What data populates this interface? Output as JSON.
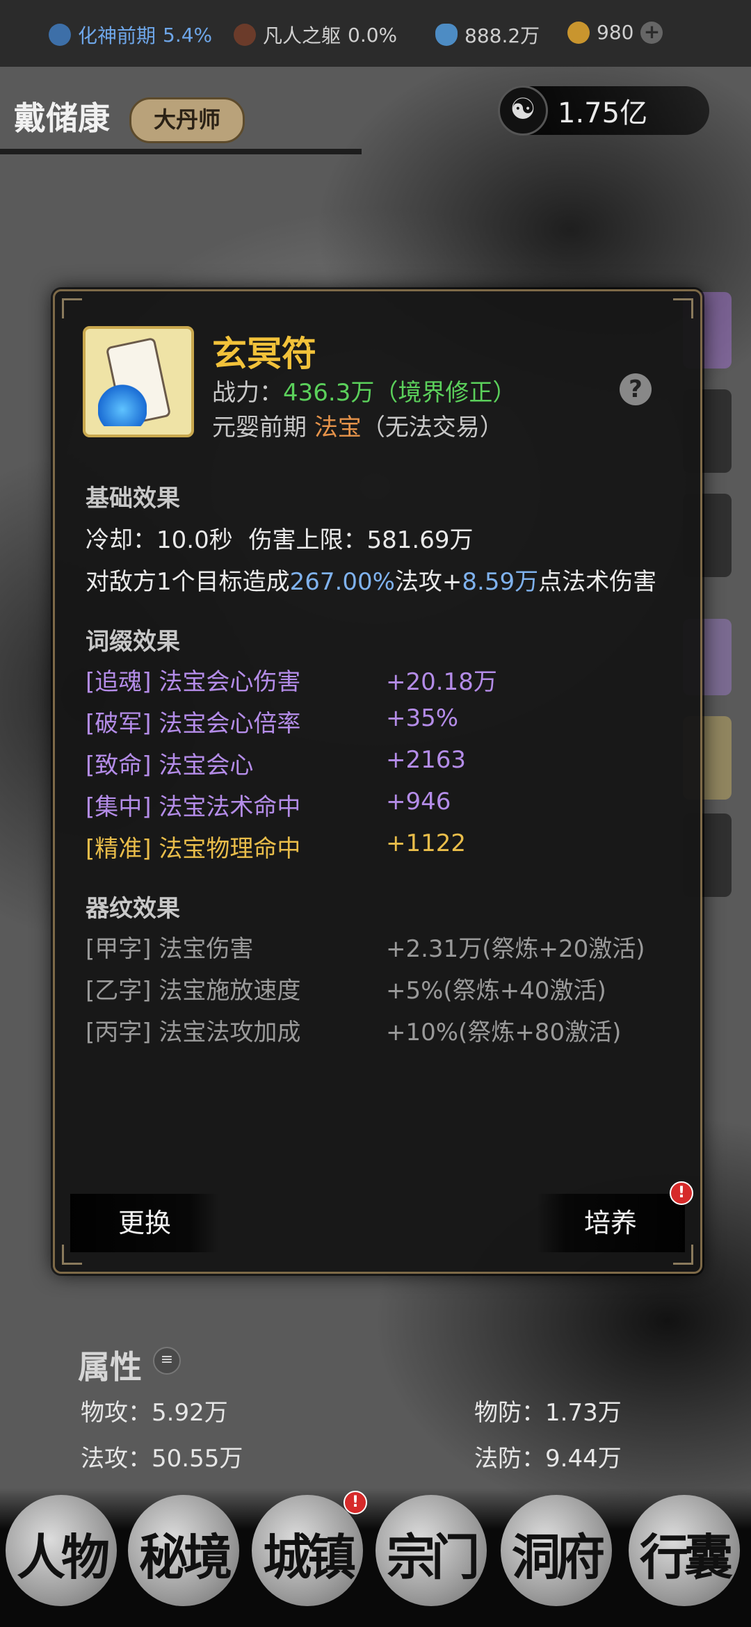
{
  "status_bar": {
    "realm": {
      "label": "化神前期",
      "value": "5.4%"
    },
    "body": {
      "label": "凡人之躯",
      "value": "0.0%"
    },
    "spirit_stones": "888.2万",
    "gold": "980",
    "add_symbol": "+"
  },
  "header": {
    "player_name": "戴储康",
    "title_badge": "大丹师",
    "currency_value": "1.75亿",
    "currency_icon": "taiji-icon"
  },
  "item": {
    "name": "玄冥符",
    "power_label": "战力：",
    "power_value": "436.3万",
    "power_note": "（境界修正）",
    "realm": "元婴前期",
    "type": "法宝",
    "trade_note": "（无法交易）",
    "help_symbol": "?",
    "base_title": "基础效果",
    "cooldown_label": "冷却：",
    "cooldown_value": "10.0秒",
    "damage_cap_label": "伤害上限：",
    "damage_cap_value": "581.69万",
    "effect_prefix": "对敌方1个目标造成",
    "effect_percent": "267.00%",
    "effect_mid": "法攻+",
    "effect_flat": "8.59万",
    "effect_suffix": "点法术伤害",
    "affix_title": "词缀效果",
    "affixes": [
      {
        "label": "[追魂] 法宝会心伤害",
        "value": "+20.18万",
        "color": "#b48ce8"
      },
      {
        "label": "[破军] 法宝会心倍率",
        "value": "+35%",
        "color": "#b48ce8"
      },
      {
        "label": "[致命] 法宝会心",
        "value": "+2163",
        "color": "#b48ce8"
      },
      {
        "label": "[集中] 法宝法术命中",
        "value": "+946",
        "color": "#b48ce8"
      },
      {
        "label": "[精准] 法宝物理命中",
        "value": "+1122",
        "color": "#e9bd4a"
      }
    ],
    "pattern_title": "器纹效果",
    "patterns": [
      {
        "label": "[甲字] 法宝伤害",
        "value": "+2.31万(祭炼+20激活)"
      },
      {
        "label": "[乙字] 法宝施放速度",
        "value": "+5%(祭炼+40激活)"
      },
      {
        "label": "[丙字] 法宝法攻加成",
        "value": "+10%(祭炼+80激活)"
      }
    ],
    "button_replace": "更换",
    "button_cultivate": "培养",
    "alert_symbol": "!"
  },
  "attributes": {
    "title": "属性",
    "phys_atk_label": "物攻：",
    "phys_atk": "5.92万",
    "phys_def_label": "物防：",
    "phys_def": "1.73万",
    "mag_atk_label": "法攻：",
    "mag_atk": "50.55万",
    "mag_def_label": "法防：",
    "mag_def": "9.44万"
  },
  "nav": [
    {
      "label": "人物"
    },
    {
      "label": "秘境"
    },
    {
      "label": "城镇"
    },
    {
      "label": "宗门"
    },
    {
      "label": "洞府"
    },
    {
      "label": "行囊"
    }
  ]
}
